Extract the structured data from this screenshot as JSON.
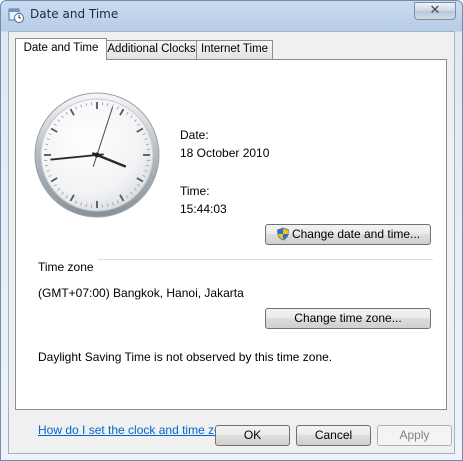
{
  "window": {
    "title": "Date and Time",
    "close_glyph": "✕",
    "icon": "date-time-icon"
  },
  "tabs": [
    {
      "label": "Date and Time",
      "active": true
    },
    {
      "label": "Additional Clocks",
      "active": false
    },
    {
      "label": "Internet Time",
      "active": false
    }
  ],
  "date": {
    "label": "Date:",
    "value": "18 October 2010"
  },
  "time": {
    "label": "Time:",
    "value": "15:44:03"
  },
  "clock": {
    "hours": 15,
    "minutes": 44,
    "seconds": 3
  },
  "change_datetime_button": "Change date and time...",
  "timezone": {
    "heading": "Time zone",
    "value": "(GMT+07:00) Bangkok, Hanoi, Jakarta",
    "change_button": "Change time zone...",
    "dst_note": "Daylight Saving Time is not observed by this time zone."
  },
  "help_link": "How do I set the clock and time zone?",
  "footer": {
    "ok": "OK",
    "cancel": "Cancel",
    "apply": "Apply"
  }
}
